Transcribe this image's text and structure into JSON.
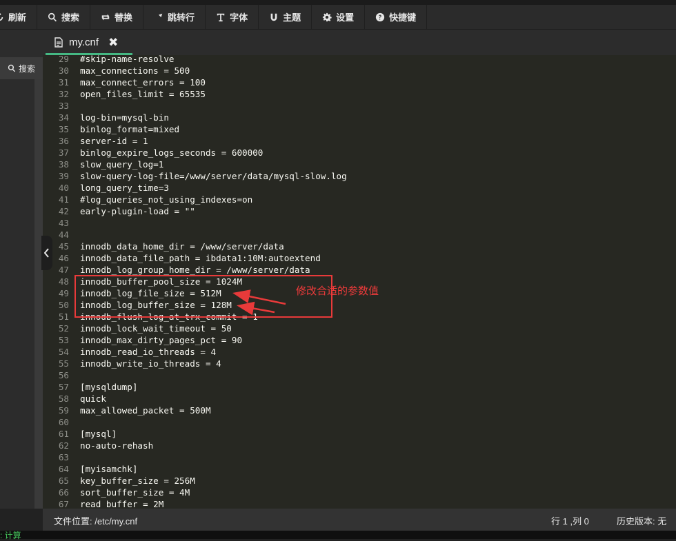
{
  "toolbar": {
    "refresh": "刷新",
    "search": "搜索",
    "replace": "替换",
    "goto": "跳转行",
    "font": "字体",
    "theme": "主题",
    "settings": "设置",
    "shortcuts": "快捷键"
  },
  "sidebar": {
    "search_label": "搜索"
  },
  "tab": {
    "filename": "my.cnf",
    "close_glyph": "✖"
  },
  "editor": {
    "lines": [
      {
        "n": "29",
        "t": "#skip-name-resolve"
      },
      {
        "n": "30",
        "t": "max_connections = 500"
      },
      {
        "n": "31",
        "t": "max_connect_errors = 100"
      },
      {
        "n": "32",
        "t": "open_files_limit = 65535"
      },
      {
        "n": "33",
        "t": ""
      },
      {
        "n": "34",
        "t": "log-bin=mysql-bin"
      },
      {
        "n": "35",
        "t": "binlog_format=mixed"
      },
      {
        "n": "36",
        "t": "server-id = 1"
      },
      {
        "n": "37",
        "t": "binlog_expire_logs_seconds = 600000"
      },
      {
        "n": "38",
        "t": "slow_query_log=1"
      },
      {
        "n": "39",
        "t": "slow-query-log-file=/www/server/data/mysql-slow.log"
      },
      {
        "n": "40",
        "t": "long_query_time=3"
      },
      {
        "n": "41",
        "t": "#log_queries_not_using_indexes=on"
      },
      {
        "n": "42",
        "t": "early-plugin-load = \"\""
      },
      {
        "n": "43",
        "t": ""
      },
      {
        "n": "44",
        "t": ""
      },
      {
        "n": "45",
        "t": "innodb_data_home_dir = /www/server/data"
      },
      {
        "n": "46",
        "t": "innodb_data_file_path = ibdata1:10M:autoextend"
      },
      {
        "n": "47",
        "t": "innodb_log_group_home_dir = /www/server/data"
      },
      {
        "n": "48",
        "t": "innodb_buffer_pool_size = 1024M"
      },
      {
        "n": "49",
        "t": "innodb_log_file_size = 512M"
      },
      {
        "n": "50",
        "t": "innodb_log_buffer_size = 128M"
      },
      {
        "n": "51",
        "t": "innodb_flush_log_at_trx_commit = 1"
      },
      {
        "n": "52",
        "t": "innodb_lock_wait_timeout = 50"
      },
      {
        "n": "53",
        "t": "innodb_max_dirty_pages_pct = 90"
      },
      {
        "n": "54",
        "t": "innodb_read_io_threads = 4"
      },
      {
        "n": "55",
        "t": "innodb_write_io_threads = 4"
      },
      {
        "n": "56",
        "t": ""
      },
      {
        "n": "57",
        "t": "[mysqldump]"
      },
      {
        "n": "58",
        "t": "quick"
      },
      {
        "n": "59",
        "t": "max_allowed_packet = 500M"
      },
      {
        "n": "60",
        "t": ""
      },
      {
        "n": "61",
        "t": "[mysql]"
      },
      {
        "n": "62",
        "t": "no-auto-rehash"
      },
      {
        "n": "63",
        "t": ""
      },
      {
        "n": "64",
        "t": "[myisamchk]"
      },
      {
        "n": "65",
        "t": "key_buffer_size = 256M"
      },
      {
        "n": "66",
        "t": "sort_buffer_size = 4M"
      },
      {
        "n": "67",
        "t": "read_buffer = 2M"
      }
    ]
  },
  "annotation": {
    "text": "修改合适的参数值",
    "color": "#e83a3a"
  },
  "status": {
    "path": "文件位置: /etc/my.cnf",
    "position": "行 1 ,列 0",
    "history": "历史版本: 无"
  },
  "bottom": {
    "text": ": 计算"
  },
  "colors": {
    "accent": "#45b883",
    "editor_bg": "#272822",
    "text": "#f8f8f2",
    "gutter": "#8f908a"
  }
}
